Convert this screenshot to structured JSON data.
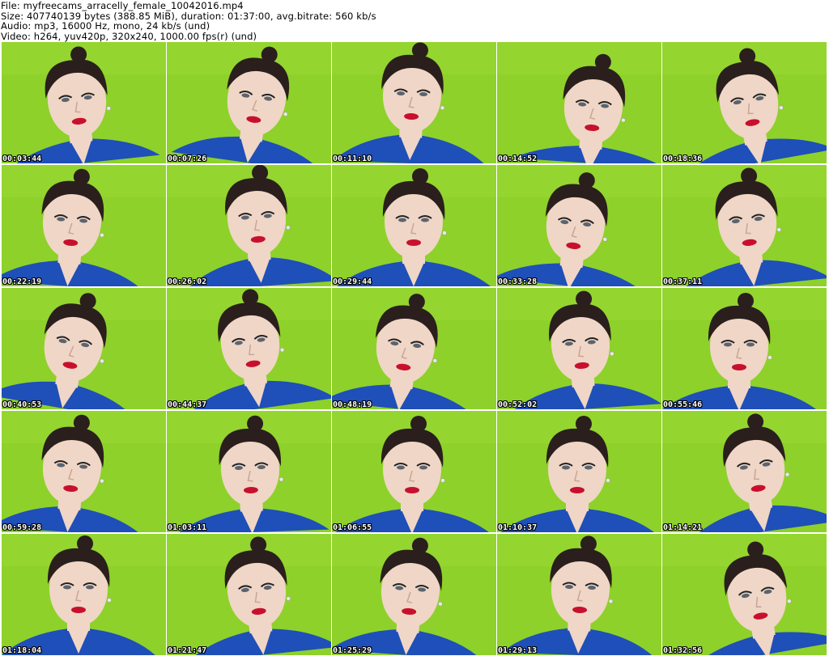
{
  "header": {
    "file": "File: myfreecams_arracelly_female_10042016.mp4",
    "size": "Size: 407740139 bytes (388.85 MiB), duration: 01:37:00, avg.bitrate: 560 kb/s",
    "audio": "Audio: mp3, 16000 Hz, mono, 24 kb/s (und)",
    "video": "Video: h264, yuv420p, 320x240, 1000.00 fps(r) (und)"
  },
  "colors": {
    "background": "#8ed12a",
    "shirt": "#1f4fb8",
    "skin": "#f0d6c6",
    "hair": "#2a1f1c",
    "lips": "#c8102e",
    "timestamp_text": "#ffffff",
    "timestamp_outline": "#000000"
  },
  "frames": [
    {
      "time": "00:03:44"
    },
    {
      "time": "00:07:26"
    },
    {
      "time": "00:11:10"
    },
    {
      "time": "00:14:52"
    },
    {
      "time": "00:18:36"
    },
    {
      "time": "00:22:19"
    },
    {
      "time": "00:26:02"
    },
    {
      "time": "00:29:44"
    },
    {
      "time": "00:33:28"
    },
    {
      "time": "00:37:11"
    },
    {
      "time": "00:40:53"
    },
    {
      "time": "00:44:37"
    },
    {
      "time": "00:48:19"
    },
    {
      "time": "00:52:02"
    },
    {
      "time": "00:55:46"
    },
    {
      "time": "00:59:28"
    },
    {
      "time": "01:03:11"
    },
    {
      "time": "01:06:55"
    },
    {
      "time": "01:10:37"
    },
    {
      "time": "01:14:21"
    },
    {
      "time": "01:18:04"
    },
    {
      "time": "01:21:47"
    },
    {
      "time": "01:25:29"
    },
    {
      "time": "01:29:13"
    },
    {
      "time": "01:32:56"
    }
  ]
}
